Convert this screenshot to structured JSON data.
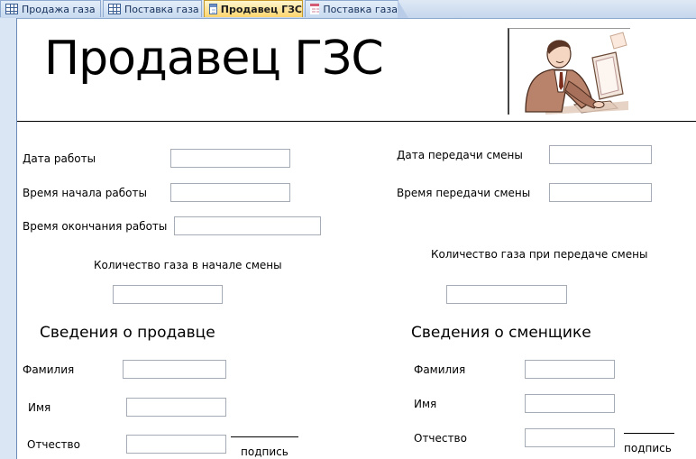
{
  "tabs": [
    {
      "label": "Продажа газа",
      "icon": "table-icon"
    },
    {
      "label": "Поставка газа",
      "icon": "table-icon"
    },
    {
      "label": "Продавец ГЗС",
      "icon": "form-icon",
      "active": true
    },
    {
      "label": "Поставка газа",
      "icon": "form-icon"
    }
  ],
  "form": {
    "title": "Продавец ГЗС",
    "picture": "clipart-man-at-computer",
    "left": {
      "work_date": {
        "label": "Дата работы",
        "value": ""
      },
      "start_time": {
        "label": "Время начала работы",
        "value": ""
      },
      "end_time": {
        "label": "Время окончания работы",
        "value": ""
      },
      "gas_start": {
        "label": "Количество газа в начале смены",
        "value": ""
      }
    },
    "right": {
      "handover_date": {
        "label": "Дата передачи смены",
        "value": ""
      },
      "handover_time": {
        "label": "Время передачи смены",
        "value": ""
      },
      "gas_handover": {
        "label": "Количество газа при передаче смены",
        "value": ""
      }
    },
    "seller": {
      "heading": "Сведения о продавце",
      "surname": {
        "label": "Фамилия",
        "value": ""
      },
      "name": {
        "label": "Имя",
        "value": ""
      },
      "patronymic": {
        "label": "Отчество",
        "value": ""
      },
      "signature": "подпись"
    },
    "relief": {
      "heading": "Сведения о сменщике",
      "surname": {
        "label": "Фамилия",
        "value": ""
      },
      "name": {
        "label": "Имя",
        "value": ""
      },
      "patronymic": {
        "label": "Отчество",
        "value": ""
      },
      "signature": "подпись"
    }
  },
  "colors": {
    "active_tab": "#ffd56e",
    "tab": "#c8daf0",
    "gutter": "#dbe6f4"
  }
}
